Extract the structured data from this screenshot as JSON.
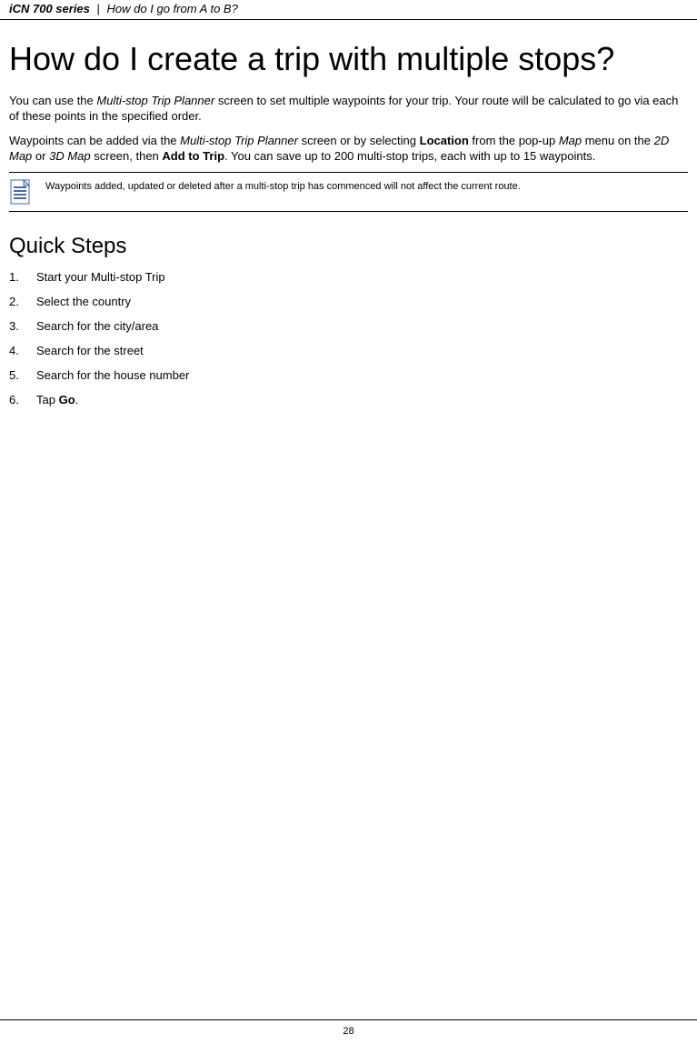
{
  "header": {
    "series": "iCN 700 series",
    "separator": "|",
    "chapter": "How do I go from A to B?"
  },
  "title": "How do I create a trip with multiple stops?",
  "intro": {
    "p1_a": "You can use the ",
    "p1_b": "Multi-stop Trip Planner",
    "p1_c": " screen to set multiple waypoints for your trip. Your route will be calculated to go via each of these points in the specified order.",
    "p2_a": "Waypoints can be added via the ",
    "p2_b": "Multi-stop Trip Planner",
    "p2_c": " screen or by selecting ",
    "p2_d": "Location",
    "p2_e": " from the pop-up ",
    "p2_f": "Map",
    "p2_g": " menu on the ",
    "p2_h": "2D Map",
    "p2_i": " or ",
    "p2_j": "3D Map",
    "p2_k": " screen, then ",
    "p2_l": "Add to Trip",
    "p2_m": ". You can save up to 200 multi-stop trips, each with up to 15 waypoints."
  },
  "note": {
    "text": "Waypoints added, updated or deleted after a multi-stop trip has commenced will not affect the current route."
  },
  "quick_steps": {
    "heading": "Quick Steps",
    "items": [
      {
        "num": "1.",
        "text": "Start your Multi-stop Trip"
      },
      {
        "num": "2.",
        "text": "Select the country"
      },
      {
        "num": "3.",
        "text": "Search for the city/area"
      },
      {
        "num": "4.",
        "text": "Search for the street"
      },
      {
        "num": "5.",
        "text": "Search for the house number"
      },
      {
        "num": "6.",
        "text_a": "Tap ",
        "text_b": "Go",
        "text_c": "."
      }
    ]
  },
  "page_number": "28"
}
